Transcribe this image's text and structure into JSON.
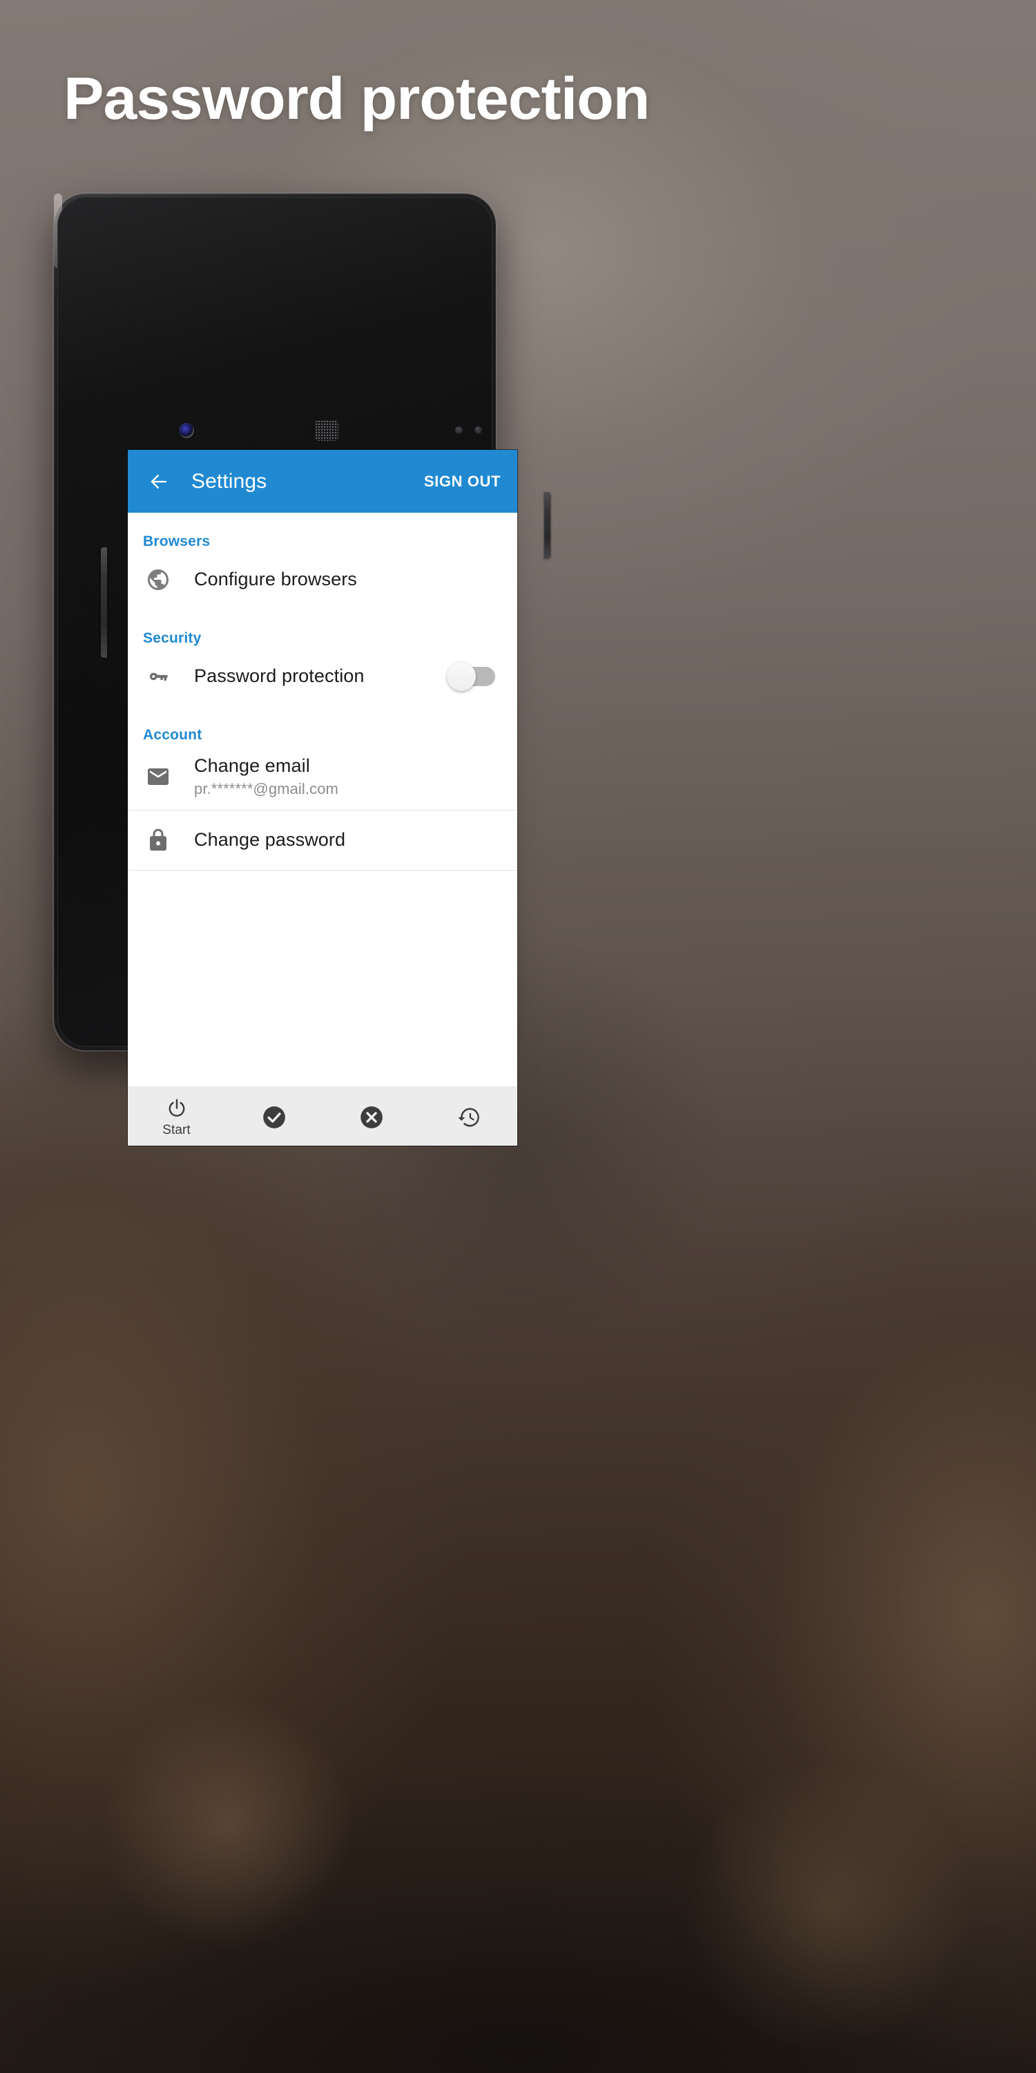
{
  "page": {
    "headline": "Password protection",
    "background_color": "#6f6662",
    "accent_color": "#2089d2"
  },
  "device": {
    "name": "android-phone-mockup",
    "camera": "front-camera",
    "speaker": "earpiece-speaker"
  },
  "appbar": {
    "back_icon": "arrow-back-icon",
    "title": "Settings",
    "action_label": "SIGN OUT",
    "background_color": "#2089d2",
    "text_color": "#ffffff"
  },
  "sections": [
    {
      "header": "Browsers",
      "rows": [
        {
          "icon": "globe-icon",
          "title": "Configure browsers",
          "subtitle": "",
          "control": "none"
        }
      ]
    },
    {
      "header": "Security",
      "rows": [
        {
          "icon": "key-icon",
          "title": "Password protection",
          "subtitle": "",
          "control": "toggle",
          "toggle_state": "off"
        }
      ]
    },
    {
      "header": "Account",
      "rows": [
        {
          "icon": "email-icon",
          "title": "Change email",
          "subtitle": "pr.*******@gmail.com",
          "control": "none"
        },
        {
          "icon": "lock-icon",
          "title": "Change password",
          "subtitle": "",
          "control": "none"
        }
      ]
    }
  ],
  "bottom_nav": {
    "background_color": "#ececec",
    "items": [
      {
        "icon": "power-icon",
        "label": "Start"
      },
      {
        "icon": "check-circle-icon",
        "label": ""
      },
      {
        "icon": "close-circle-icon",
        "label": ""
      },
      {
        "icon": "history-icon",
        "label": ""
      }
    ]
  }
}
